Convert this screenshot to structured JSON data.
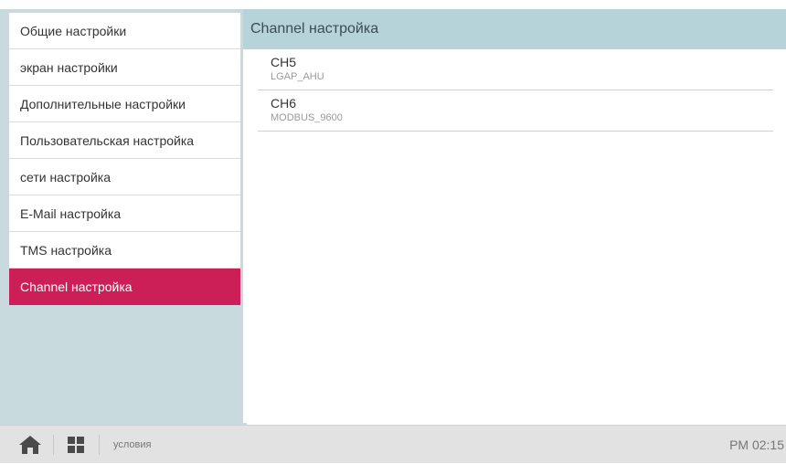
{
  "sidebar": {
    "items": [
      {
        "label": "Общие настройки"
      },
      {
        "label": "экран настройки"
      },
      {
        "label": "Дополнительные настройки"
      },
      {
        "label": "Пользовательская настройка"
      },
      {
        "label": "сети настройка"
      },
      {
        "label": "E-Mail настройка"
      },
      {
        "label": "TMS настройка"
      },
      {
        "label": "Channel настройка"
      }
    ],
    "active_index": 7
  },
  "main": {
    "title": "Channel настройка",
    "channels": [
      {
        "name": "CH5",
        "protocol": "LGAP_AHU"
      },
      {
        "name": "CH6",
        "protocol": "MODBUS_9600"
      }
    ]
  },
  "bottombar": {
    "home_icon": "home-icon",
    "menu_icon": "grid-menu-icon",
    "status": "условия",
    "clock": "PM 02:15"
  },
  "colors": {
    "accent": "#cd1f57",
    "sidebar_bg": "#c9dade",
    "header_bg": "#b6d3d9",
    "bottombar_bg": "#e2e2e2"
  }
}
